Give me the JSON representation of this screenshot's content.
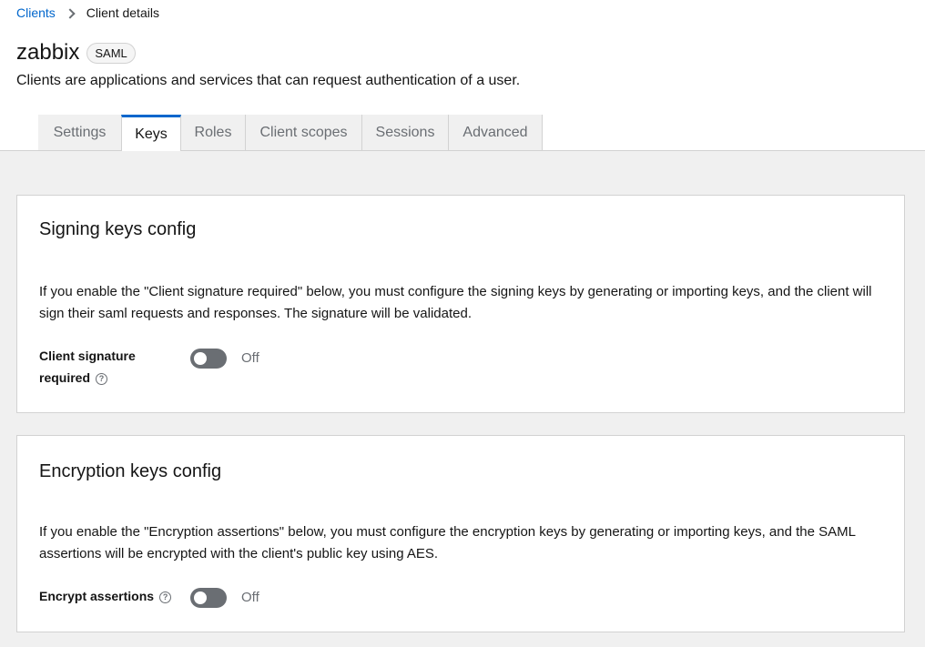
{
  "breadcrumb": {
    "parent": "Clients",
    "current": "Client details"
  },
  "header": {
    "title": "zabbix",
    "badge": "SAML",
    "subtitle": "Clients are applications and services that can request authentication of a user."
  },
  "tabs": [
    {
      "label": "Settings",
      "active": false
    },
    {
      "label": "Keys",
      "active": true
    },
    {
      "label": "Roles",
      "active": false
    },
    {
      "label": "Client scopes",
      "active": false
    },
    {
      "label": "Sessions",
      "active": false
    },
    {
      "label": "Advanced",
      "active": false
    }
  ],
  "signing": {
    "title": "Signing keys config",
    "description": "If you enable the \"Client signature required\" below, you must configure the signing keys by generating or importing keys, and the client will sign their saml requests and responses. The signature will be validated.",
    "field_label_line1": "Client signature",
    "field_label_line2": "required",
    "toggle_state": "Off"
  },
  "encryption": {
    "title": "Encryption keys config",
    "description": "If you enable the \"Encryption assertions\" below, you must configure the encryption keys by generating or importing keys, and the SAML assertions will be encrypted with the client's public key using AES.",
    "field_label": "Encrypt assertions",
    "toggle_state": "Off"
  },
  "icons": {
    "help": "help-circle-icon",
    "breadcrumb_separator": "chevron-right-icon"
  },
  "colors": {
    "accent": "#0066cc",
    "toggle_off": "#6a6e73",
    "page_bg": "#f0f0f0"
  }
}
